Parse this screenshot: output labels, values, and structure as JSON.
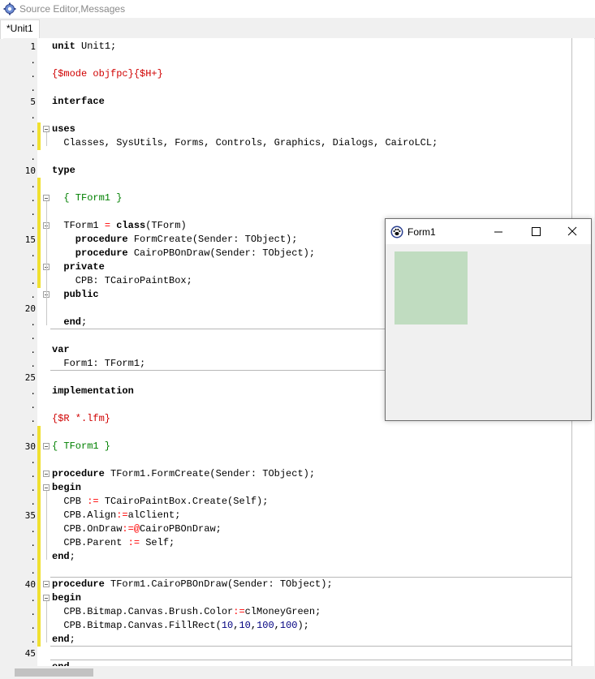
{
  "window": {
    "title": "Source Editor,Messages"
  },
  "tabs": [
    {
      "label": "*Unit1"
    }
  ],
  "gutter": {
    "numbers": [
      "1",
      "5",
      "10",
      "15",
      "20",
      "25",
      "30",
      "35",
      "40",
      "45"
    ],
    "dot": "."
  },
  "code": [
    [
      [
        "kw",
        "unit "
      ],
      [
        "id",
        "Unit1;"
      ]
    ],
    [],
    [
      [
        "dir",
        "{$mode objfpc}{$H+}"
      ]
    ],
    [],
    [
      [
        "kw",
        "interface"
      ]
    ],
    [],
    [
      [
        "kw",
        "uses"
      ]
    ],
    [
      [
        "id",
        "  Classes, SysUtils, Forms, Controls, Graphics, Dialogs, CairoLCL;"
      ]
    ],
    [],
    [
      [
        "kw",
        "type"
      ]
    ],
    [],
    [
      [
        "cm",
        "  { TForm1 }"
      ]
    ],
    [],
    [
      [
        "id",
        "  TForm1 "
      ],
      [
        "sym",
        "= "
      ],
      [
        "kw",
        "class"
      ],
      [
        "id",
        "(TForm)"
      ]
    ],
    [
      [
        "kw",
        "    procedure "
      ],
      [
        "id",
        "FormCreate(Sender: TObject);"
      ]
    ],
    [
      [
        "kw",
        "    procedure "
      ],
      [
        "id",
        "CairoPBOnDraw(Sender: TObject);"
      ]
    ],
    [
      [
        "kw",
        "  private"
      ]
    ],
    [
      [
        "id",
        "    CPB: TCairoPaintBox;"
      ]
    ],
    [
      [
        "kw",
        "  public"
      ]
    ],
    [],
    [
      [
        "kw",
        "  end"
      ],
      [
        "id",
        ";"
      ]
    ],
    [],
    [
      [
        "kw",
        "var"
      ]
    ],
    [
      [
        "id",
        "  Form1: TForm1;"
      ]
    ],
    [],
    [
      [
        "kw",
        "implementation"
      ]
    ],
    [],
    [
      [
        "dir",
        "{$R *.lfm}"
      ]
    ],
    [],
    [
      [
        "cm",
        "{ TForm1 }"
      ]
    ],
    [],
    [
      [
        "kw",
        "procedure "
      ],
      [
        "id",
        "TForm1.FormCreate(Sender: TObject);"
      ]
    ],
    [
      [
        "kw",
        "begin"
      ]
    ],
    [
      [
        "id",
        "  CPB "
      ],
      [
        "sym",
        ":= "
      ],
      [
        "id",
        "TCairoPaintBox.Create(Self);"
      ]
    ],
    [
      [
        "id",
        "  CPB.Align"
      ],
      [
        "sym",
        ":="
      ],
      [
        "id",
        "alClient;"
      ]
    ],
    [
      [
        "id",
        "  CPB.OnDraw"
      ],
      [
        "sym",
        ":=@"
      ],
      [
        "id",
        "CairoPBOnDraw;"
      ]
    ],
    [
      [
        "id",
        "  CPB.Parent "
      ],
      [
        "sym",
        ":= "
      ],
      [
        "id",
        "Self;"
      ]
    ],
    [
      [
        "kw",
        "end"
      ],
      [
        "id",
        ";"
      ]
    ],
    [],
    [
      [
        "kw",
        "procedure "
      ],
      [
        "id",
        "TForm1.CairoPBOnDraw(Sender: TObject);"
      ]
    ],
    [
      [
        "kw",
        "begin"
      ]
    ],
    [
      [
        "id",
        "  CPB.Bitmap.Canvas.Brush.Color"
      ],
      [
        "sym",
        ":="
      ],
      [
        "id",
        "clMoneyGreen;"
      ]
    ],
    [
      [
        "id",
        "  CPB.Bitmap.Canvas.FillRect("
      ],
      [
        "num",
        "10"
      ],
      [
        "id",
        ","
      ],
      [
        "num",
        "10"
      ],
      [
        "id",
        ","
      ],
      [
        "num",
        "100"
      ],
      [
        "id",
        ","
      ],
      [
        "num",
        "100"
      ],
      [
        "id",
        ");"
      ]
    ],
    [
      [
        "kw",
        "end"
      ],
      [
        "id",
        ";"
      ]
    ],
    [],
    [
      [
        "kw",
        "end"
      ],
      [
        "id",
        "."
      ]
    ]
  ],
  "form": {
    "title": "Form1",
    "paintbox_color": "#c0dcc0"
  },
  "colors": {
    "keyword": "#000000",
    "directive": "#d00000",
    "comment": "#008000",
    "number": "#000080",
    "symbol": "#ff0000",
    "modified_marker": "#f0e030"
  }
}
